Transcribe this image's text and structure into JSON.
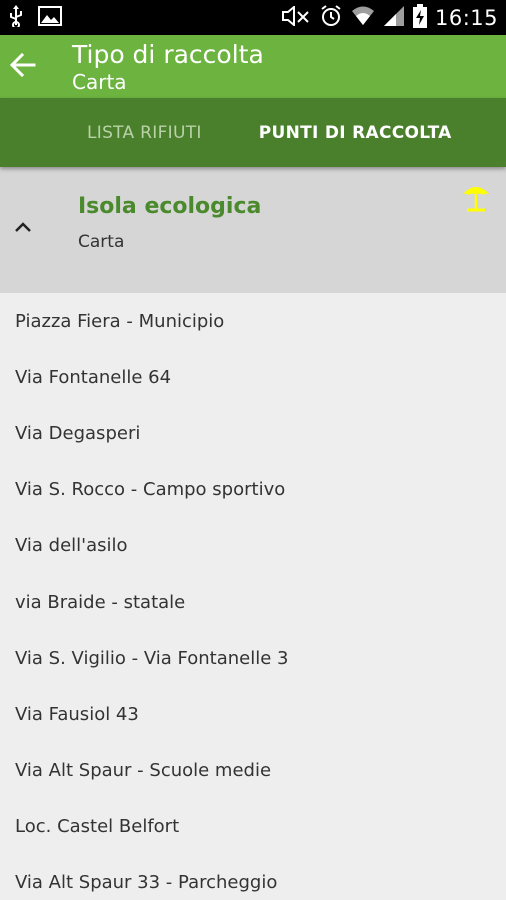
{
  "status_bar": {
    "time": "16:15"
  },
  "app_bar": {
    "title": "Tipo di raccolta",
    "subtitle": "Carta"
  },
  "tabs": [
    {
      "label": "LISTA RIFIUTI",
      "selected": false
    },
    {
      "label": "PUNTI DI RACCOLTA",
      "selected": true
    }
  ],
  "group": {
    "title": "Isola ecologica",
    "subtitle": "Carta",
    "expanded": true
  },
  "items": [
    {
      "label": "Piazza Fiera - Municipio"
    },
    {
      "label": "Via Fontanelle 64"
    },
    {
      "label": "Via Degasperi"
    },
    {
      "label": "Via S. Rocco - Campo sportivo"
    },
    {
      "label": "Via dell'asilo"
    },
    {
      "label": "via Braide - statale"
    },
    {
      "label": "Via S. Vigilio - Via Fontanelle 3"
    },
    {
      "label": "Via Fausiol 43"
    },
    {
      "label": "Via Alt Spaur - Scuole medie"
    },
    {
      "label": "Loc. Castel Belfort"
    },
    {
      "label": "Via Alt Spaur 33 - Parcheggio"
    }
  ],
  "colors": {
    "app_bar": "#6cb33f",
    "tab_bar": "#4a7f2c",
    "group_title": "#4a8a2c",
    "umbrella": "#ffff00"
  }
}
